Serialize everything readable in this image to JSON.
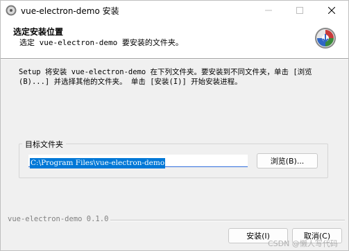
{
  "window": {
    "title": "vue-electron-demo 安装",
    "minimize_glyph": "─",
    "maximize_glyph": "☐",
    "close_glyph": "✕"
  },
  "header": {
    "title": "选定安装位置",
    "subtitle": "选定 vue-electron-demo 要安装的文件夹。"
  },
  "description": "Setup 将安装 vue-electron-demo 在下列文件夹。要安装到不同文件夹，单击 [浏览(B)...] 并选择其他的文件夹。 单击 [安装(I)] 开始安装进程。",
  "target_group": {
    "label": "目标文件夹",
    "path_value": "C:\\Program Files\\vue-electron-demo",
    "browse_label": "浏览(B)..."
  },
  "footer": {
    "branding": "vue-electron-demo 0.1.0",
    "install_label": "安装(I)",
    "cancel_label": "取消(C)",
    "watermark": "CSDN @懒人写代码"
  },
  "colors": {
    "selection": "#0078d7",
    "window_bg": "#f0f0f0",
    "header_bg": "#ffffff"
  },
  "icons": {
    "app": "installer-disc-icon",
    "header_logo": "installer-disc-icon"
  }
}
